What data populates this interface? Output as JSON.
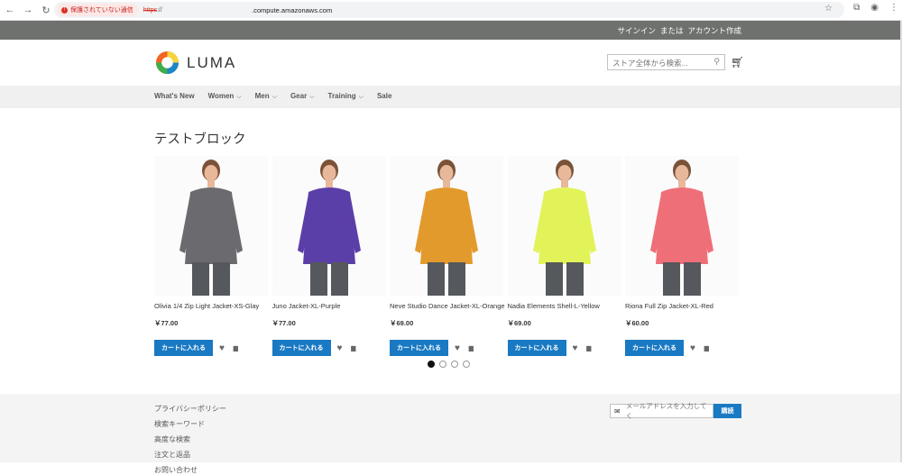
{
  "browser": {
    "security_warning": "保護されていない通信",
    "url_scheme": "https",
    "url_scheme_rest": "://",
    "url_host": ".compute.amazonaws.com"
  },
  "header": {
    "signin": "サインイン",
    "or": "または",
    "create_account": "アカウント作成",
    "logo_text": "LUMA",
    "search_placeholder": "ストア全体から検索..."
  },
  "nav": {
    "items": [
      {
        "label": "What's New",
        "has_caret": false
      },
      {
        "label": "Women",
        "has_caret": true
      },
      {
        "label": "Men",
        "has_caret": true
      },
      {
        "label": "Gear",
        "has_caret": true
      },
      {
        "label": "Training",
        "has_caret": true
      },
      {
        "label": "Sale",
        "has_caret": false
      }
    ]
  },
  "block": {
    "title": "テストブロック"
  },
  "products": [
    {
      "name": "Olivia 1/4 Zip Light Jacket-XS-Glay",
      "price": "￥77.00",
      "color": "#6b6a6e"
    },
    {
      "name": "Juno Jacket-XL-Purple",
      "price": "￥77.00",
      "color": "#5b3fa8"
    },
    {
      "name": "Neve Studio Dance Jacket-XL-Orange",
      "price": "￥69.00",
      "color": "#e39a2d"
    },
    {
      "name": "Nadia Elements Shell-L-Yellow",
      "price": "￥69.00",
      "color": "#e2f35a"
    },
    {
      "name": "Riona Full Zip Jacket-XL-Red",
      "price": "￥60.00",
      "color": "#ef6f78"
    }
  ],
  "product_actions": {
    "add_to_cart": "カートに入れる"
  },
  "carousel": {
    "pages": 4,
    "active": 0
  },
  "footer": {
    "links": [
      "プライバシーポリシー",
      "検索キーワード",
      "高度な検索",
      "注文と返品",
      "お問い合わせ"
    ],
    "newsletter_placeholder": "メールアドレスを入力してく",
    "subscribe": "購読"
  }
}
